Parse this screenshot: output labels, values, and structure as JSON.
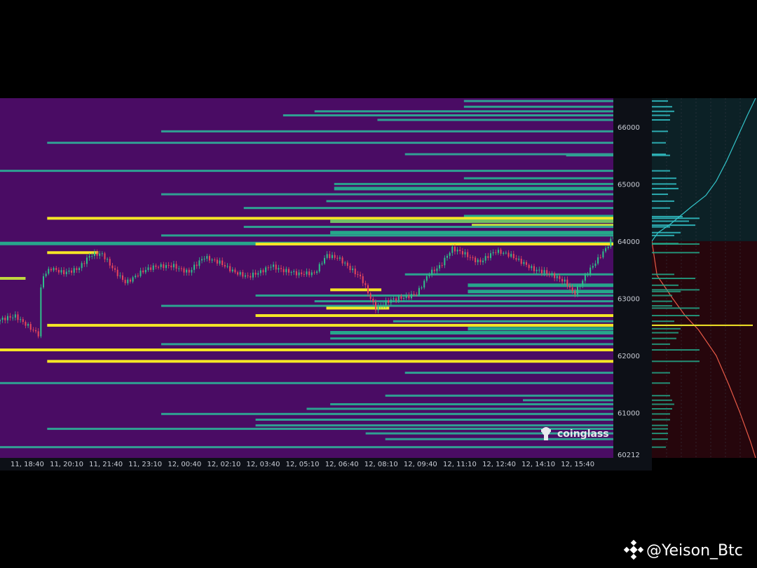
{
  "brand": {
    "name": "coinglass",
    "icon": "coinglass-logo-icon"
  },
  "attribution": {
    "text": "@Yeison_Btc",
    "icon": "binance-logo-icon"
  },
  "colors": {
    "background": "#4a0c64",
    "heat_low": "#3a9a9a",
    "heat_mid": "#23a889",
    "heat_high": "#f5e626",
    "candle_up": "#2fc08a",
    "candle_down": "#e8475c",
    "side_bg_upper": "#0c2126",
    "side_bg_lower": "#26060c",
    "side_line_upper": "#33c3c9",
    "side_line_lower": "#e85a47"
  },
  "chart_data": {
    "type": "heatmap",
    "title": "",
    "xlabel": "",
    "ylabel": "",
    "x_tick_labels": [
      "11, 18:40",
      "11, 20:10",
      "11, 21:40",
      "11, 23:10",
      "12, 00:40",
      "12, 02:10",
      "12, 03:40",
      "12, 05:10",
      "12, 06:40",
      "12, 08:10",
      "12, 09:40",
      "12, 11:10",
      "12, 12:40",
      "12, 14:10",
      "12, 15:40"
    ],
    "y_ticks": [
      66000,
      65000,
      64000,
      63000,
      62000,
      61000
    ],
    "y_min_label": "60212",
    "ylim": [
      60212,
      66500
    ],
    "x_range_index": [
      0,
      15.6
    ],
    "price_series": [
      {
        "x": 0.0,
        "y": 62600
      },
      {
        "x": 0.4,
        "y": 62700
      },
      {
        "x": 0.7,
        "y": 62550
      },
      {
        "x": 1.0,
        "y": 62350
      },
      {
        "x": 1.05,
        "y": 63350
      },
      {
        "x": 1.3,
        "y": 63500
      },
      {
        "x": 1.6,
        "y": 63450
      },
      {
        "x": 2.0,
        "y": 63550
      },
      {
        "x": 2.3,
        "y": 63750
      },
      {
        "x": 2.6,
        "y": 63750
      },
      {
        "x": 2.9,
        "y": 63500
      },
      {
        "x": 3.2,
        "y": 63300
      },
      {
        "x": 3.6,
        "y": 63450
      },
      {
        "x": 4.0,
        "y": 63550
      },
      {
        "x": 4.4,
        "y": 63600
      },
      {
        "x": 4.8,
        "y": 63450
      },
      {
        "x": 5.2,
        "y": 63700
      },
      {
        "x": 5.6,
        "y": 63650
      },
      {
        "x": 6.0,
        "y": 63450
      },
      {
        "x": 6.3,
        "y": 63350
      },
      {
        "x": 6.6,
        "y": 63450
      },
      {
        "x": 6.9,
        "y": 63600
      },
      {
        "x": 7.2,
        "y": 63500
      },
      {
        "x": 7.6,
        "y": 63400
      },
      {
        "x": 8.0,
        "y": 63450
      },
      {
        "x": 8.3,
        "y": 63780
      },
      {
        "x": 8.6,
        "y": 63700
      },
      {
        "x": 8.9,
        "y": 63500
      },
      {
        "x": 9.2,
        "y": 63350
      },
      {
        "x": 9.55,
        "y": 62850
      },
      {
        "x": 9.9,
        "y": 62950
      },
      {
        "x": 10.3,
        "y": 63000
      },
      {
        "x": 10.6,
        "y": 63100
      },
      {
        "x": 10.9,
        "y": 63450
      },
      {
        "x": 11.2,
        "y": 63550
      },
      {
        "x": 11.5,
        "y": 63850
      },
      {
        "x": 11.8,
        "y": 63800
      },
      {
        "x": 12.2,
        "y": 63650
      },
      {
        "x": 12.6,
        "y": 63800
      },
      {
        "x": 13.0,
        "y": 63750
      },
      {
        "x": 13.3,
        "y": 63650
      },
      {
        "x": 13.6,
        "y": 63500
      },
      {
        "x": 14.0,
        "y": 63400
      },
      {
        "x": 14.4,
        "y": 63300
      },
      {
        "x": 14.6,
        "y": 63100
      },
      {
        "x": 14.9,
        "y": 63400
      },
      {
        "x": 15.2,
        "y": 63650
      },
      {
        "x": 15.45,
        "y": 63900
      },
      {
        "x": 15.6,
        "y": 64100
      }
    ],
    "liquidity_levels": [
      {
        "price": 66450,
        "from": 11.8,
        "intensity": 0.25
      },
      {
        "price": 66350,
        "from": 11.8,
        "intensity": 0.35
      },
      {
        "price": 66270,
        "from": 8.0,
        "intensity": 0.4
      },
      {
        "price": 66200,
        "from": 7.2,
        "intensity": 0.3
      },
      {
        "price": 66120,
        "from": 9.6,
        "intensity": 0.3
      },
      {
        "price": 65920,
        "from": 4.1,
        "intensity": 0.25
      },
      {
        "price": 65720,
        "from": 1.2,
        "intensity": 0.2
      },
      {
        "price": 65520,
        "from": 10.3,
        "intensity": 0.2
      },
      {
        "price": 65500,
        "from": 14.4,
        "intensity": 0.3
      },
      {
        "price": 65230,
        "from": 0.0,
        "intensity": 0.3
      },
      {
        "price": 65100,
        "from": 11.8,
        "intensity": 0.45
      },
      {
        "price": 65000,
        "from": 8.5,
        "intensity": 0.45
      },
      {
        "price": 64920,
        "from": 8.5,
        "intensity": 0.5
      },
      {
        "price": 64820,
        "from": 4.1,
        "intensity": 0.25
      },
      {
        "price": 64700,
        "from": 8.3,
        "intensity": 0.4
      },
      {
        "price": 64580,
        "from": 6.2,
        "intensity": 0.3
      },
      {
        "price": 64430,
        "from": 11.8,
        "intensity": 0.6
      },
      {
        "price": 64400,
        "from": 1.2,
        "intensity": 1.0
      },
      {
        "price": 64350,
        "from": 8.4,
        "intensity": 0.75
      },
      {
        "price": 64280,
        "from": 12.0,
        "intensity": 0.9
      },
      {
        "price": 64250,
        "from": 6.2,
        "intensity": 0.3
      },
      {
        "price": 64150,
        "from": 8.4,
        "intensity": 0.55
      },
      {
        "price": 64100,
        "from": 4.1,
        "intensity": 0.4
      },
      {
        "price": 63960,
        "from": 0.0,
        "intensity": 0.5
      },
      {
        "price": 63950,
        "from": 6.5,
        "intensity": 1.0
      },
      {
        "price": 63800,
        "from": 1.2,
        "intensity": 1.0,
        "to": 2.5
      },
      {
        "price": 63420,
        "from": 10.3,
        "intensity": 0.4
      },
      {
        "price": 63350,
        "from": 0.0,
        "intensity": 0.9,
        "to": 0.65
      },
      {
        "price": 63230,
        "from": 11.9,
        "intensity": 0.5
      },
      {
        "price": 63150,
        "from": 8.4,
        "intensity": 1.0,
        "to": 9.7
      },
      {
        "price": 63120,
        "from": 11.9,
        "intensity": 0.55
      },
      {
        "price": 63050,
        "from": 6.5,
        "intensity": 0.35
      },
      {
        "price": 62950,
        "from": 8.0,
        "intensity": 0.35
      },
      {
        "price": 62870,
        "from": 4.1,
        "intensity": 0.35
      },
      {
        "price": 62830,
        "from": 8.3,
        "intensity": 1.0,
        "to": 9.9
      },
      {
        "price": 62700,
        "from": 6.5,
        "intensity": 1.0
      },
      {
        "price": 62600,
        "from": 10.0,
        "intensity": 0.4
      },
      {
        "price": 62530,
        "from": 1.2,
        "intensity": 1.0
      },
      {
        "price": 62470,
        "from": 11.9,
        "intensity": 0.55
      },
      {
        "price": 62400,
        "from": 8.4,
        "intensity": 0.5
      },
      {
        "price": 62300,
        "from": 8.4,
        "intensity": 0.45
      },
      {
        "price": 62200,
        "from": 4.1,
        "intensity": 0.3
      },
      {
        "price": 62100,
        "from": 0.0,
        "intensity": 1.0
      },
      {
        "price": 61900,
        "from": 1.2,
        "intensity": 1.0
      },
      {
        "price": 61700,
        "from": 10.3,
        "intensity": 0.3
      },
      {
        "price": 61520,
        "from": 0.0,
        "intensity": 0.3
      },
      {
        "price": 61300,
        "from": 9.8,
        "intensity": 0.3
      },
      {
        "price": 61220,
        "from": 13.3,
        "intensity": 0.35
      },
      {
        "price": 61150,
        "from": 8.4,
        "intensity": 0.4
      },
      {
        "price": 61070,
        "from": 7.8,
        "intensity": 0.35
      },
      {
        "price": 60980,
        "from": 4.1,
        "intensity": 0.3
      },
      {
        "price": 60880,
        "from": 6.5,
        "intensity": 0.3
      },
      {
        "price": 60780,
        "from": 6.5,
        "intensity": 0.25
      },
      {
        "price": 60720,
        "from": 1.2,
        "intensity": 0.25
      },
      {
        "price": 60640,
        "from": 9.3,
        "intensity": 0.25
      },
      {
        "price": 60540,
        "from": 9.8,
        "intensity": 0.25
      },
      {
        "price": 60400,
        "from": 0.0,
        "intensity": 0.2
      }
    ],
    "side_profile": {
      "current_price": 64000,
      "cumulative_shorts": [
        {
          "price": 64000,
          "value": 0.0
        },
        {
          "price": 64150,
          "value": 0.06
        },
        {
          "price": 64300,
          "value": 0.18
        },
        {
          "price": 64600,
          "value": 0.38
        },
        {
          "price": 64800,
          "value": 0.52
        },
        {
          "price": 65050,
          "value": 0.62
        },
        {
          "price": 65400,
          "value": 0.72
        },
        {
          "price": 65800,
          "value": 0.82
        },
        {
          "price": 66200,
          "value": 0.92
        },
        {
          "price": 66500,
          "value": 1.0
        }
      ],
      "cumulative_longs": [
        {
          "price": 64000,
          "value": 0.0
        },
        {
          "price": 63400,
          "value": 0.05
        },
        {
          "price": 63000,
          "value": 0.2
        },
        {
          "price": 62700,
          "value": 0.32
        },
        {
          "price": 62450,
          "value": 0.45
        },
        {
          "price": 62000,
          "value": 0.62
        },
        {
          "price": 61500,
          "value": 0.74
        },
        {
          "price": 61000,
          "value": 0.85
        },
        {
          "price": 60500,
          "value": 0.95
        },
        {
          "price": 60212,
          "value": 1.0
        }
      ],
      "highlight_price": 62530
    }
  }
}
